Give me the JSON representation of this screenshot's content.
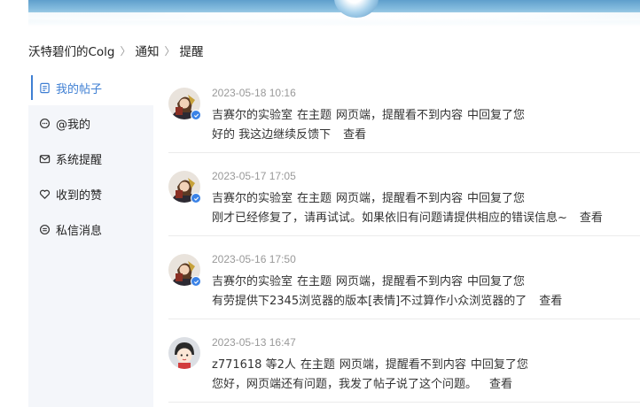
{
  "breadcrumb": {
    "items": [
      "沃特碧们的Colg",
      "通知",
      "提醒"
    ]
  },
  "sidebar": {
    "active_color": "#3f7fd3",
    "items": [
      {
        "label": "我的帖子",
        "icon": "document-icon",
        "active": true
      },
      {
        "label": "@我的",
        "icon": "chat-bubble-icon",
        "active": false
      },
      {
        "label": "系统提醒",
        "icon": "mail-icon",
        "active": false
      },
      {
        "label": "收到的赞",
        "icon": "heart-icon",
        "active": false
      },
      {
        "label": "私信消息",
        "icon": "message-icon",
        "active": false
      }
    ]
  },
  "notices": [
    {
      "time": "2023-05-18 10:16",
      "author": "吉赛尔的实验室",
      "action": "在主题",
      "topic": "网页端，提醒看不到内容",
      "suffix": "中回复了您",
      "content": "好的  我这边继续反馈下",
      "view": "查看",
      "avatar": "character-avatar",
      "verified": true
    },
    {
      "time": "2023-05-17 17:05",
      "author": "吉赛尔的实验室",
      "action": "在主题",
      "topic": "网页端，提醒看不到内容",
      "suffix": "中回复了您",
      "content": "刚才已经修复了，请再试试。如果依旧有问题请提供相应的错误信息~",
      "view": "查看",
      "avatar": "character-avatar",
      "verified": true
    },
    {
      "time": "2023-05-16 17:50",
      "author": "吉赛尔的实验室",
      "action": "在主题",
      "topic": "网页端，提醒看不到内容",
      "suffix": "中回复了您",
      "content": "有劳提供下2345浏览器的版本[表情]不过算作小众浏览器的了",
      "view": "查看",
      "avatar": "character-avatar",
      "verified": true
    },
    {
      "time": "2023-05-13 16:47",
      "author": "z771618 等2人",
      "action": "在主题",
      "topic": "网页端，提醒看不到内容",
      "suffix": "中回复了您",
      "content": "您好，网页端还有问题，我发了帖子说了这个问题。",
      "view": "查看",
      "avatar": "default-avatar",
      "verified": false
    }
  ]
}
